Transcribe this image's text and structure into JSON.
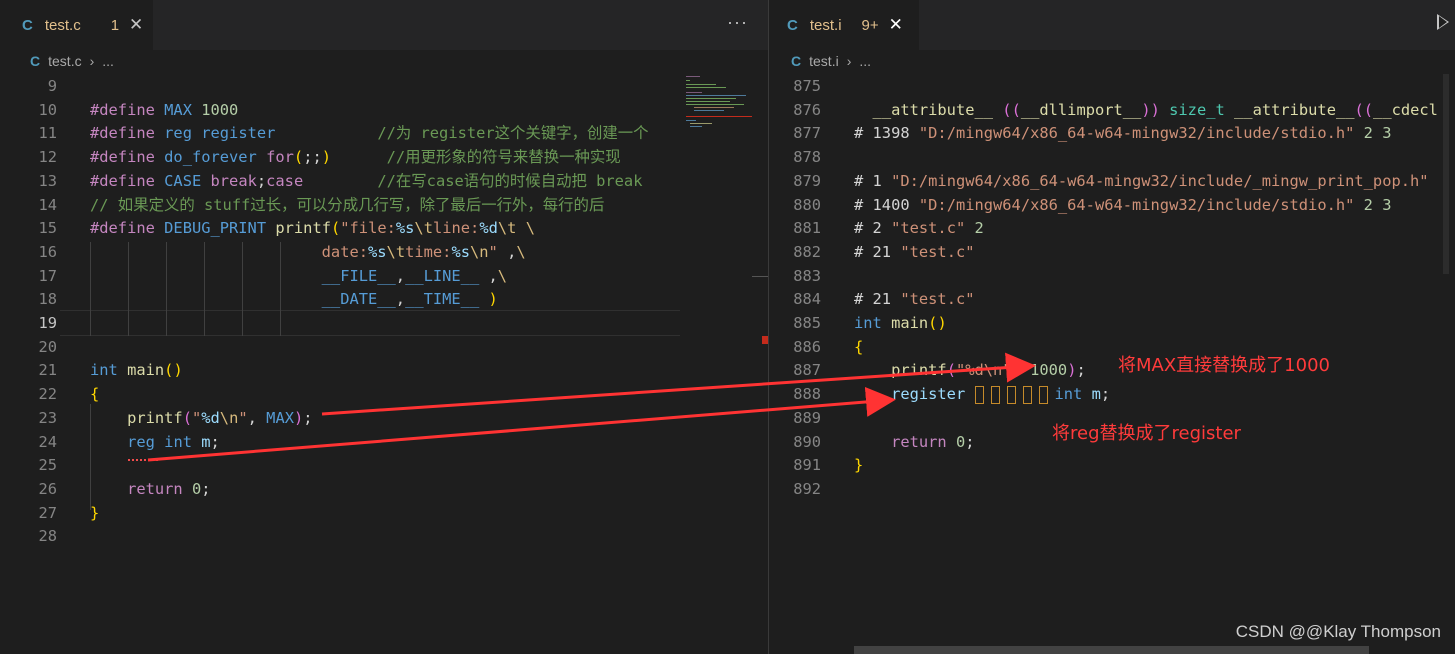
{
  "left_editor": {
    "tab": {
      "icon": "C",
      "name": "test.c",
      "badge": "1",
      "close": "✕"
    },
    "more": "···",
    "breadcrumb": {
      "icon": "C",
      "file": "test.c",
      "sep": "›",
      "rest": "..."
    },
    "lines": [
      {
        "n": "9",
        "html": ""
      },
      {
        "n": "10",
        "html": "<span class='k'>#define</span> <span class='m'>MAX</span> <span class='n'>1000</span>"
      },
      {
        "n": "11",
        "html": "<span class='k'>#define</span> <span class='m'>reg</span> <span class='m'>register</span>           <span class='c'>//为 register这个关键字，创建一个</span>"
      },
      {
        "n": "12",
        "html": "<span class='k'>#define</span> <span class='m'>do_forever</span> <span class='k'>for</span><span class='y'>(</span><span class='w'>;;</span><span class='y'>)</span>      <span class='c'>//用更形象的符号来替换一种实现</span>"
      },
      {
        "n": "13",
        "html": "<span class='k'>#define</span> <span class='m'>CASE</span> <span class='k'>break</span><span class='w'>;</span><span class='k'>case</span>        <span class='c'>//在写case语句的时候自动把 break</span>"
      },
      {
        "n": "14",
        "html": "<span class='c'>// 如果定义的 stuff过长，可以分成几行写，除了最后一行外，每行的后</span>"
      },
      {
        "n": "15",
        "html": "<span class='k'>#define</span> <span class='m'>DEBUG_PRINT</span> <span class='f'>printf</span><span class='y'>(</span><span class='s'>\"file:</span><span class='v'>%s</span><span class='e'>\\t</span><span class='s'>line:</span><span class='v'>%d</span><span class='e'>\\t</span> <span class='e'>\\</span>"
      },
      {
        "n": "16",
        "html": "                         <span class='s'>date:</span><span class='v'>%s</span><span class='e'>\\t</span><span class='s'>time:</span><span class='v'>%s</span><span class='e'>\\n</span><span class='s'>\"</span> <span class='w'>,</span><span class='e'>\\</span>"
      },
      {
        "n": "17",
        "html": "                         <span class='m'>__FILE__</span><span class='w'>,</span><span class='m'>__LINE__</span> <span class='w'>,</span><span class='e'>\\</span>"
      },
      {
        "n": "18",
        "html": "                         <span class='m'>__DATE__</span><span class='w'>,</span><span class='m'>__TIME__</span> <span class='y'>)</span>"
      },
      {
        "n": "19",
        "html": "",
        "cur": true
      },
      {
        "n": "20",
        "html": ""
      },
      {
        "n": "21",
        "html": "<span class='b'>int</span> <span class='f'>main</span><span class='y'>()</span>"
      },
      {
        "n": "22",
        "html": "<span class='y'>{</span>"
      },
      {
        "n": "23",
        "html": "    <span class='f'>printf</span><span class='p'>(</span><span class='s'>\"</span><span class='v'>%d</span><span class='e'>\\n</span><span class='s'>\"</span><span class='w'>, </span><span class='m'>MAX</span><span class='p'>)</span><span class='w'>;</span>"
      },
      {
        "n": "24",
        "html": "    <span class='m'>reg</span> <span class='b'>int</span> <span class='v'>m</span><span class='w'>;</span>"
      },
      {
        "n": "25",
        "html": ""
      },
      {
        "n": "26",
        "html": "    <span class='k'>return</span> <span class='n'>0</span><span class='w'>;</span>"
      },
      {
        "n": "27",
        "html": "<span class='y'>}</span>"
      },
      {
        "n": "28",
        "html": ""
      }
    ]
  },
  "right_editor": {
    "tab": {
      "icon": "C",
      "name": "test.i",
      "badge": "9+",
      "close": "✕"
    },
    "breadcrumb": {
      "icon": "C",
      "file": "test.i",
      "sep": "›",
      "rest": "..."
    },
    "lines": [
      {
        "n": "875",
        "html": ""
      },
      {
        "n": "876",
        "html": "  <span class='f'>__attribute__</span> <span class='p'>((</span><span class='f'>__dllimport__</span><span class='p'>))</span> <span class='t'>size_t</span> <span class='f'>__attribute__</span><span class='p'>((</span><span class='f'>__cdecl</span>"
      },
      {
        "n": "877",
        "html": "<span class='w'># 1398</span> <span class='s'>\"D:/mingw64/x86_64-w64-mingw32/include/stdio.h\"</span> <span class='n'>2 3</span>"
      },
      {
        "n": "878",
        "html": ""
      },
      {
        "n": "879",
        "html": "<span class='w'># 1</span> <span class='s'>\"D:/mingw64/x86_64-w64-mingw32/include/_mingw_print_pop.h\"</span>"
      },
      {
        "n": "880",
        "html": "<span class='w'># 1400</span> <span class='s'>\"D:/mingw64/x86_64-w64-mingw32/include/stdio.h\"</span> <span class='n'>2 3</span>"
      },
      {
        "n": "881",
        "html": "<span class='w'># 2</span> <span class='s'>\"test.c\"</span> <span class='n'>2</span>"
      },
      {
        "n": "882",
        "html": "<span class='w'># 21</span> <span class='s'>\"test.c\"</span>"
      },
      {
        "n": "883",
        "html": ""
      },
      {
        "n": "884",
        "html": "<span class='w'># 21</span> <span class='s'>\"test.c\"</span>"
      },
      {
        "n": "885",
        "html": "<span class='b'>int</span> <span class='f'>main</span><span class='y'>()</span>"
      },
      {
        "n": "886",
        "html": "<span class='y'>{</span>"
      },
      {
        "n": "887",
        "html": "    <span class='f'>printf</span><span class='p'>(</span><span class='s'>\"%d\\n\"</span><span class='w'>, </span><span class='n'>1000</span><span class='p'>)</span><span class='w'>;</span>"
      },
      {
        "n": "888",
        "html": "    <span class='v'>register</span> <span class='box'></span><span class='box'></span><span class='box'></span><span class='box'></span><span class='box'></span><span class='b'>int</span> <span class='v'>m</span><span class='w'>;</span>"
      },
      {
        "n": "889",
        "html": ""
      },
      {
        "n": "890",
        "html": "    <span class='k'>return</span> <span class='n'>0</span><span class='w'>;</span>"
      },
      {
        "n": "891",
        "html": "<span class='y'>}</span>"
      },
      {
        "n": "892",
        "html": ""
      }
    ]
  },
  "annotations": {
    "max_note": "将MAX直接替换成了1000",
    "reg_note": "将reg替换成了register"
  },
  "watermark": "CSDN @@Klay Thompson",
  "colors": {
    "annotation": "#ff3b3b",
    "arrow": "#ff3333",
    "tab_modified": "#e2c08d",
    "c_icon": "#519aba"
  }
}
